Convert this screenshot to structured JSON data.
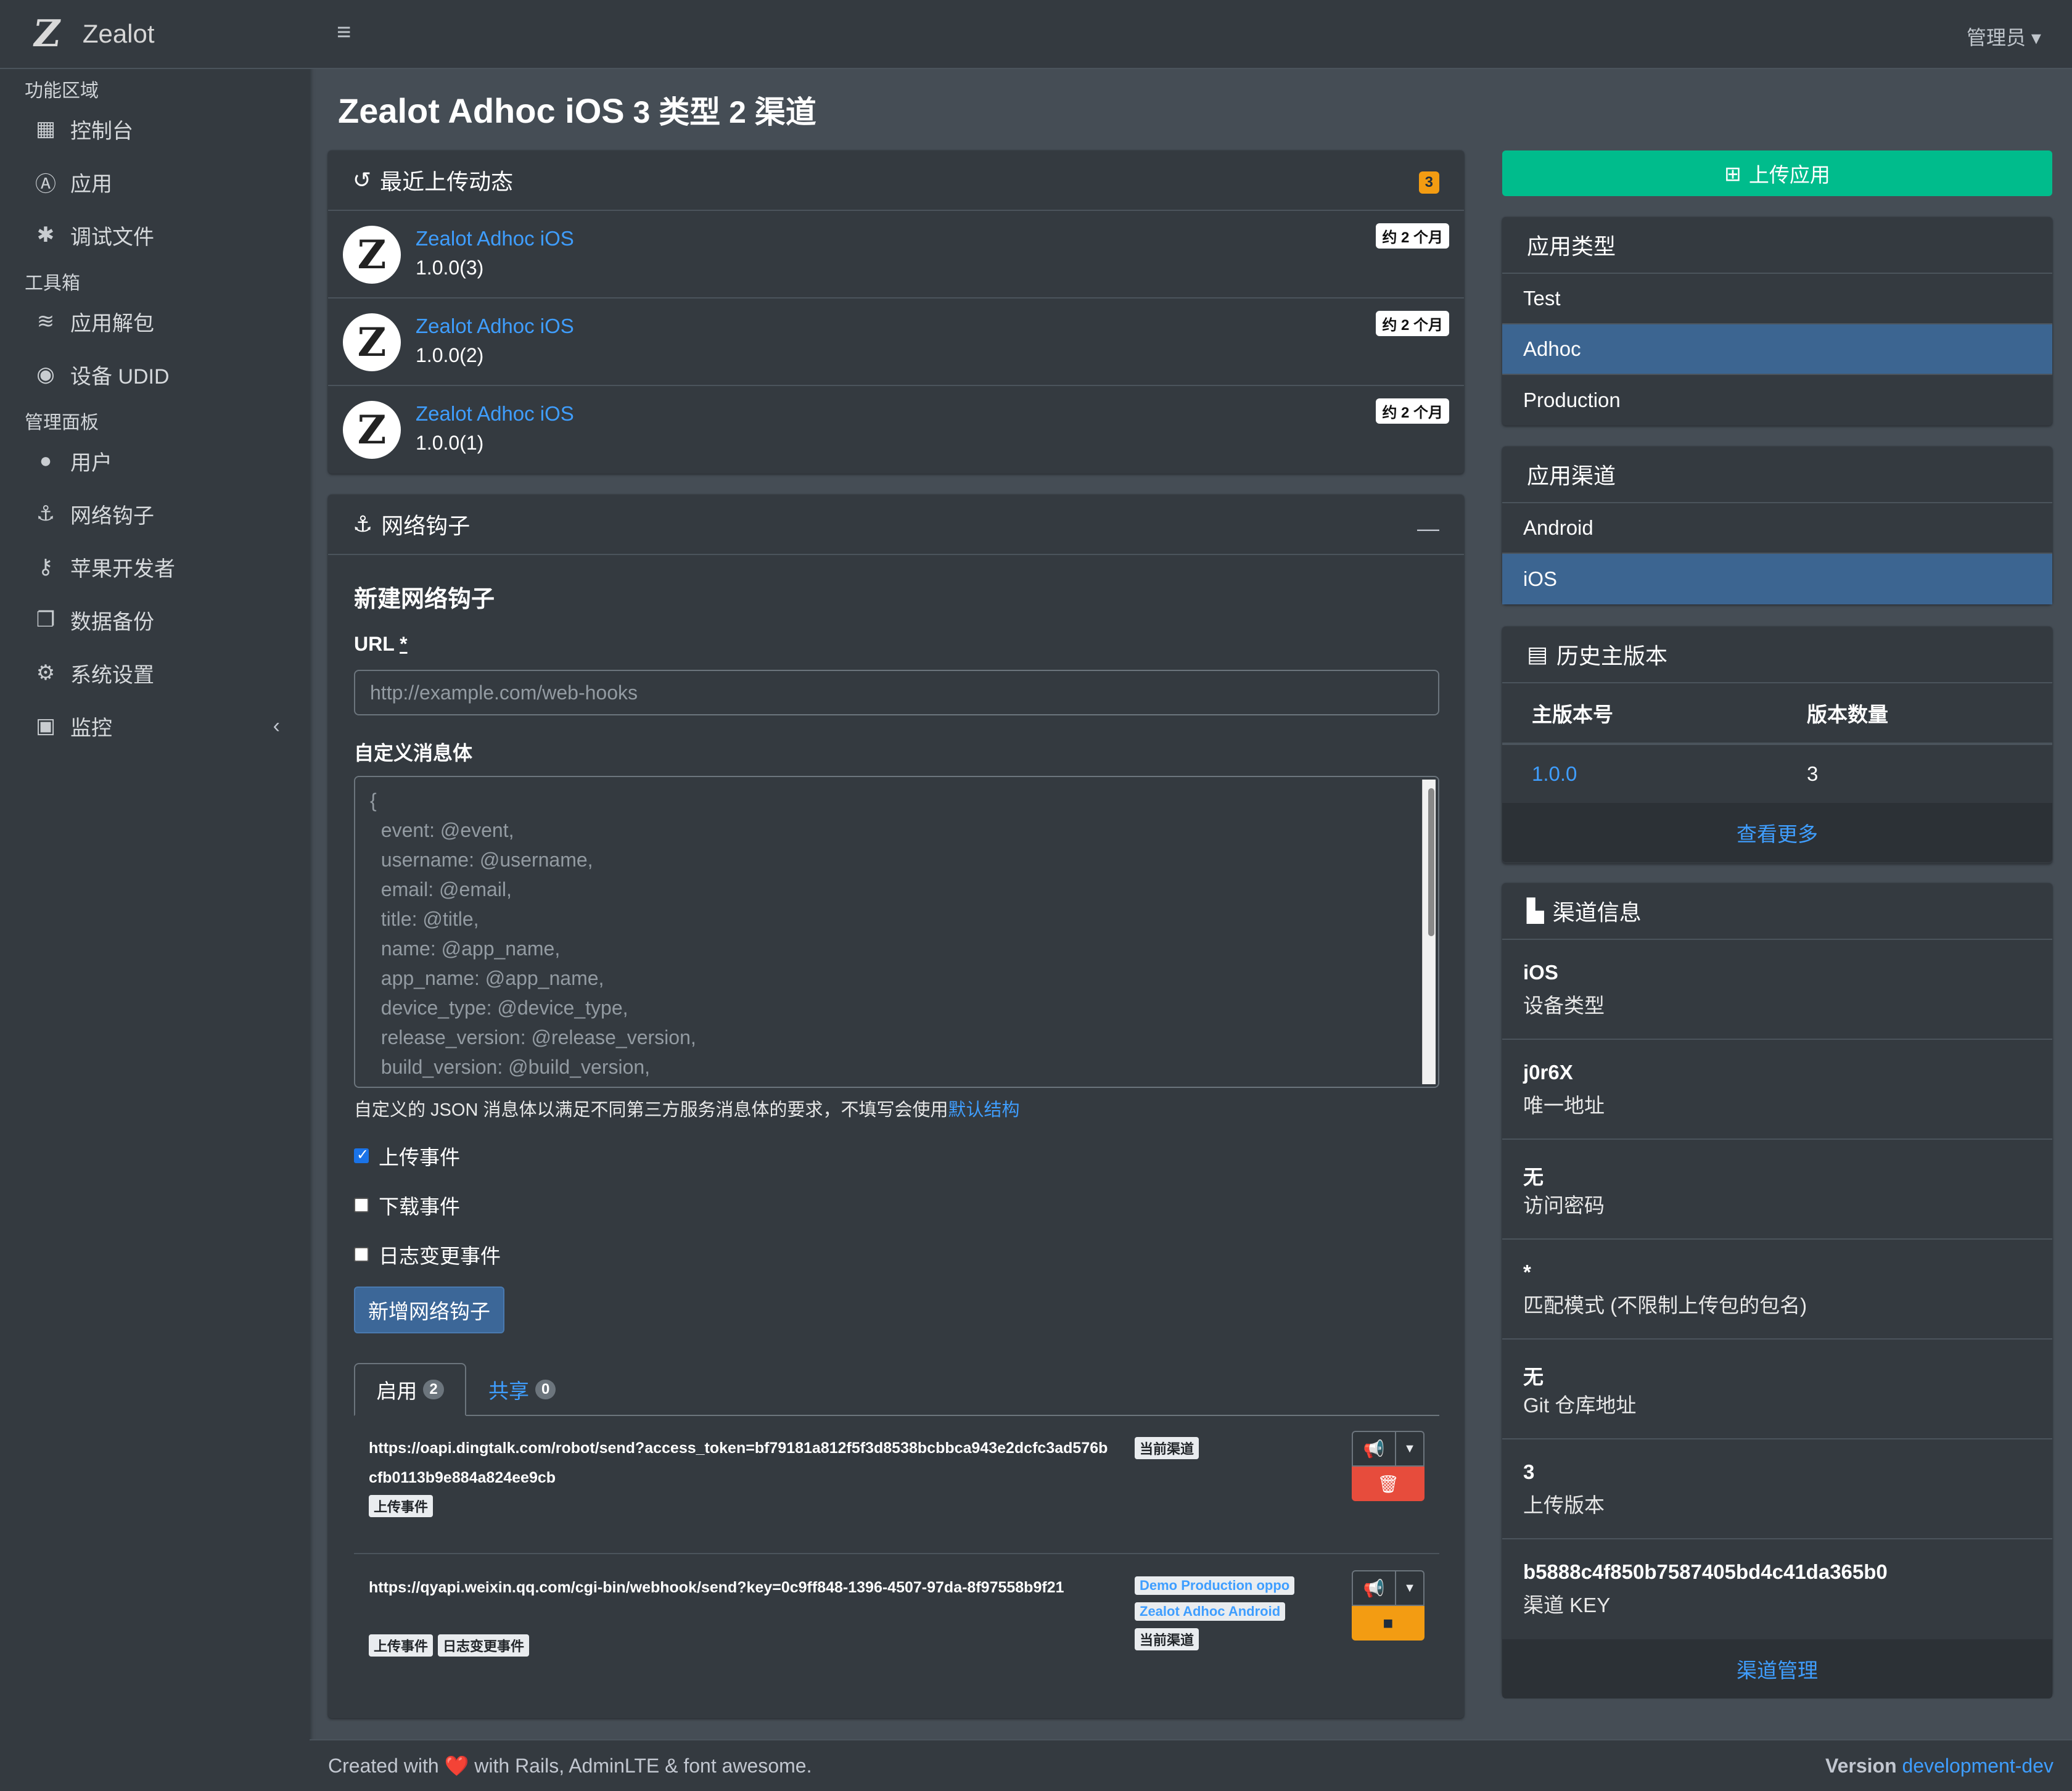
{
  "brand": {
    "logo": "Z",
    "name": "Zealot"
  },
  "sidebar": {
    "sections": [
      {
        "header": "功能区域",
        "items": [
          {
            "icon": "grid-icon",
            "glyph": "▦",
            "label": "控制台"
          },
          {
            "icon": "app-store-icon",
            "glyph": "Ⓐ",
            "label": "应用"
          },
          {
            "icon": "bug-icon",
            "glyph": "✱",
            "label": "调试文件"
          }
        ]
      },
      {
        "header": "工具箱",
        "items": [
          {
            "icon": "layers-icon",
            "glyph": "≋",
            "label": "应用解包"
          },
          {
            "icon": "eye-icon",
            "glyph": "◉",
            "label": "设备 UDID"
          }
        ]
      },
      {
        "header": "管理面板",
        "items": [
          {
            "icon": "user-icon",
            "glyph": "●",
            "label": "用户"
          },
          {
            "icon": "anchor-icon",
            "glyph": "⚓",
            "label": "网络钩子"
          },
          {
            "icon": "key-icon",
            "glyph": "⚷",
            "label": "苹果开发者"
          },
          {
            "icon": "copy-icon",
            "glyph": "❐",
            "label": "数据备份"
          },
          {
            "icon": "gear-icon",
            "glyph": "⚙",
            "label": "系统设置"
          },
          {
            "icon": "monitor-icon",
            "glyph": "▣",
            "label": "监控"
          }
        ]
      }
    ]
  },
  "topbar": {
    "menu_glyph": "≡",
    "user": "管理员 ▾"
  },
  "page": {
    "title_main": "Zealot Adhoc iOS",
    "title_sub": " 3 类型 2 渠道"
  },
  "recent": {
    "title": "最近上传动态",
    "count": "3",
    "items": [
      {
        "name": "Zealot Adhoc iOS",
        "version": "1.0.0(3)",
        "time": "约 2 个月"
      },
      {
        "name": "Zealot Adhoc iOS",
        "version": "1.0.0(2)",
        "time": "约 2 个月"
      },
      {
        "name": "Zealot Adhoc iOS",
        "version": "1.0.0(1)",
        "time": "约 2 个月"
      }
    ]
  },
  "webhook": {
    "title": "网络钩子",
    "form_title": "新建网络钩子",
    "url_label": "URL",
    "url_required": "*",
    "url_placeholder": "http://example.com/web-hooks",
    "body_label": "自定义消息体",
    "body_placeholder": "{\n  event: @event,\n  username: @username,\n  email: @email,\n  title: @title,\n  name: @app_name,\n  app_name: @app_name,\n  device_type: @device_type,\n  release_version: @release_version,\n  build_version: @build_version,",
    "help": "自定义的 JSON 消息体以满足不同第三方服务消息体的要求，不填写会使用",
    "help_link": "默认结构",
    "events": [
      {
        "label": "上传事件",
        "checked": true
      },
      {
        "label": "下载事件",
        "checked": false
      },
      {
        "label": "日志变更事件",
        "checked": false
      }
    ],
    "submit": "新增网络钩子",
    "tabs": [
      {
        "label": "启用",
        "count": "2"
      },
      {
        "label": "共享",
        "count": "0"
      }
    ],
    "hooks": [
      {
        "url": "https://oapi.dingtalk.com/robot/send?access_token=bf79181a812f5f3d8538bcbbca943e2dcfc3ad576bcfb0113b9e884a824ee9cb",
        "events": [
          "上传事件"
        ],
        "channels": [
          "当前渠道"
        ]
      },
      {
        "url": "https://qyapi.weixin.qq.com/cgi-bin/webhook/send?key=0c9ff848-1396-4507-97da-8f97558b9f21",
        "events": [
          "上传事件",
          "日志变更事件"
        ],
        "channels_linked": [
          "Demo Production oppo",
          "Zealot Adhoc Android"
        ],
        "channels": [
          "当前渠道"
        ]
      }
    ]
  },
  "right": {
    "upload_button": "上传应用",
    "types_title": "应用类型",
    "types": [
      {
        "label": "Test",
        "active": false
      },
      {
        "label": "Adhoc",
        "active": true
      },
      {
        "label": "Production",
        "active": false
      }
    ],
    "channels_title": "应用渠道",
    "channels": [
      {
        "label": "Android",
        "active": false
      },
      {
        "label": "iOS",
        "active": true
      }
    ],
    "history_title": "历史主版本",
    "history_headers": [
      "主版本号",
      "版本数量"
    ],
    "history_rows": [
      {
        "version": "1.0.0",
        "count": "3"
      }
    ],
    "history_more": "查看更多",
    "info_title": "渠道信息",
    "info": [
      {
        "value": "iOS",
        "label": "设备类型"
      },
      {
        "value": "j0r6X",
        "label": "唯一地址"
      },
      {
        "value": "无",
        "label": "访问密码"
      },
      {
        "value": "*",
        "label": "匹配模式 (不限制上传包的包名)"
      },
      {
        "value": "无",
        "label": "Git 仓库地址"
      },
      {
        "value": "3",
        "label": "上传版本"
      },
      {
        "value": "b5888c4f850b7587405bd4c41da365b0",
        "label": "渠道 KEY"
      }
    ],
    "info_manage": "渠道管理"
  },
  "footer": {
    "left_1": "Created with ",
    "heart": "❤️",
    "left_2": " with Rails, AdminLTE & font awesome.",
    "version_label": "Version",
    "version_value": "development-dev"
  },
  "colors": {
    "accent_green": "#00bc8c",
    "link": "#3f9eff",
    "danger": "#e74c3c",
    "warning": "#f39c12",
    "active_list": "#3c6591"
  }
}
